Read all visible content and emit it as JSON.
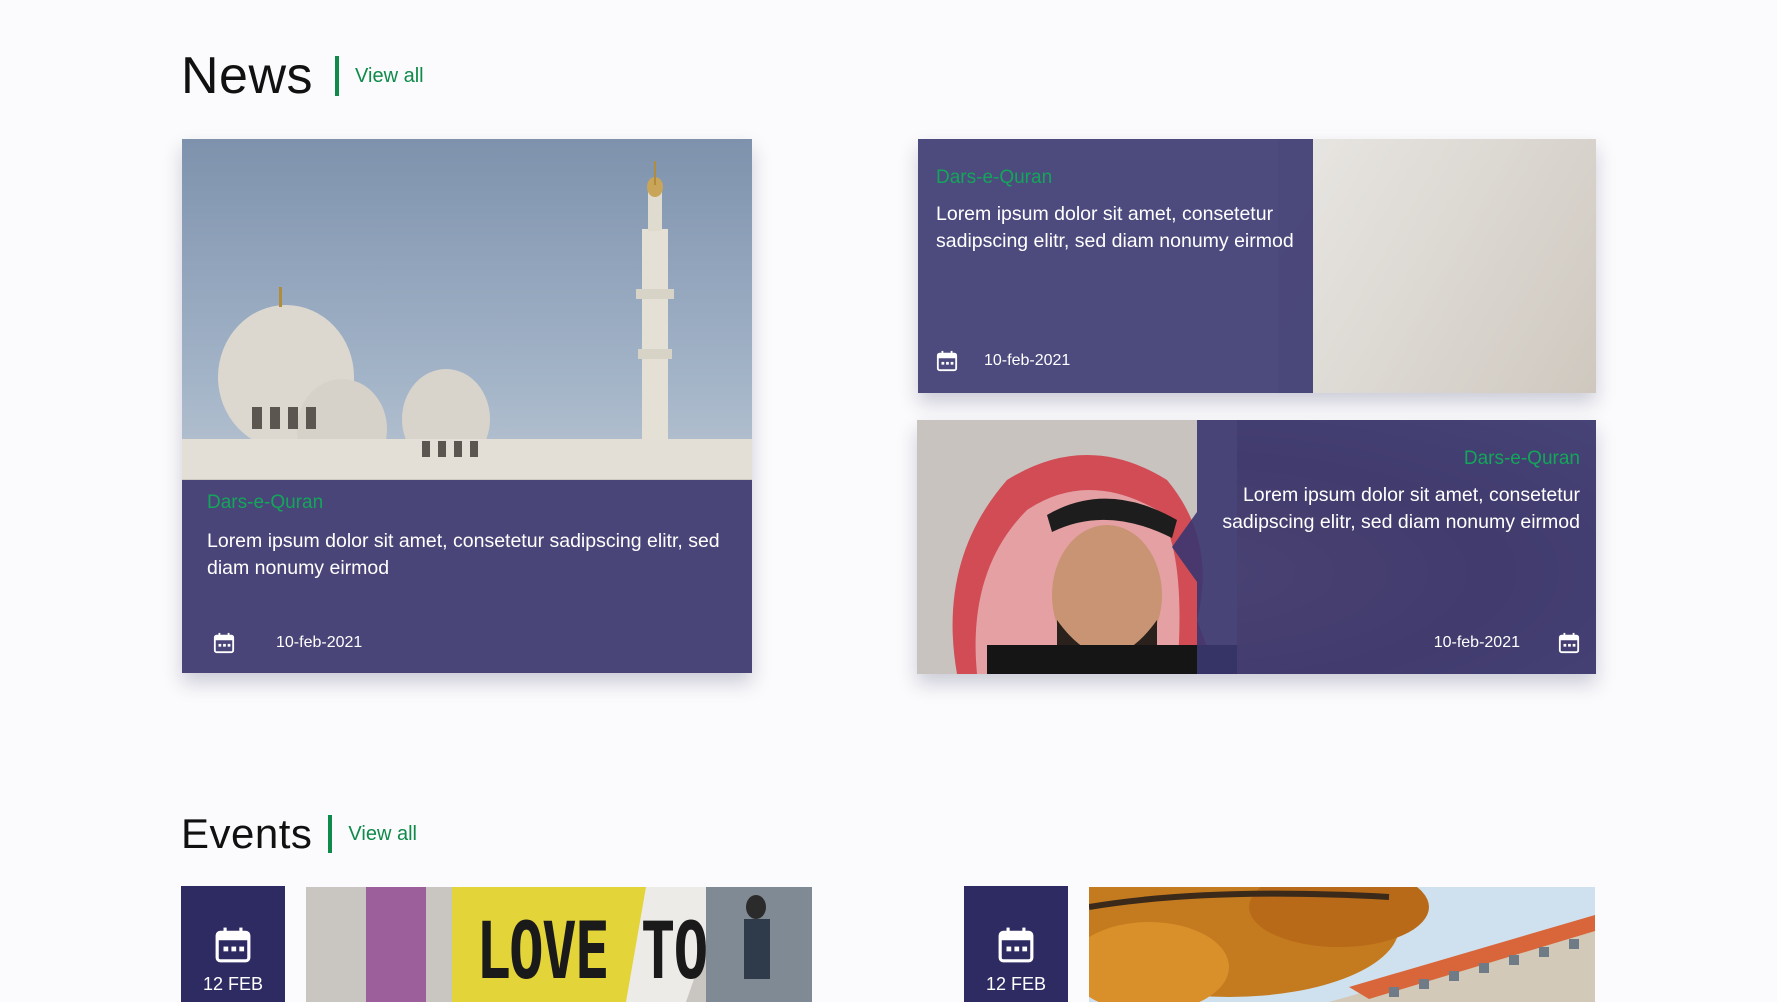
{
  "news": {
    "title": "News",
    "view_all": "View all",
    "featured": {
      "category": "Dars-e-Quran",
      "description": "Lorem ipsum dolor sit amet, consetetur sadipscing elitr, sed diam nonumy eirmod",
      "date": "10-feb-2021"
    },
    "items": [
      {
        "category": "Dars-e-Quran",
        "description": "Lorem ipsum dolor sit amet, consetetur sadipscing elitr, sed diam nonumy eirmod",
        "date": "10-feb-2021"
      },
      {
        "category": "Dars-e-Quran",
        "description": "Lorem ipsum dolor sit amet, consetetur sadipscing elitr, sed diam nonumy eirmod",
        "date": "10-feb-2021"
      }
    ]
  },
  "events": {
    "title": "Events",
    "view_all": "View all",
    "items": [
      {
        "date": "12 FEB",
        "sign_text": "LOVE TO"
      },
      {
        "date": "12 FEB"
      }
    ]
  },
  "colors": {
    "accent_green": "#0f8a4a",
    "overlay_purple": "#3a3670",
    "event_date_bg": "#2e2b63"
  },
  "icons": [
    "calendar-icon"
  ]
}
